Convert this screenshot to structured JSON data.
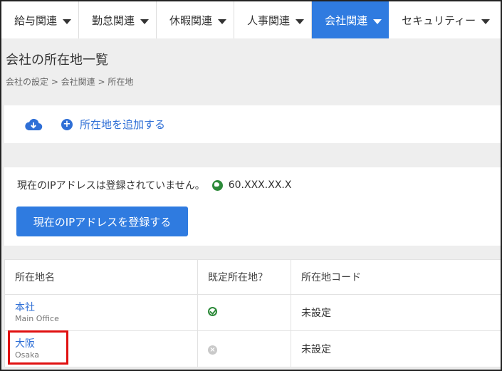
{
  "nav": {
    "items": [
      {
        "label": "給与関連",
        "active": false
      },
      {
        "label": "勤怠関連",
        "active": false
      },
      {
        "label": "休暇関連",
        "active": false
      },
      {
        "label": "人事関連",
        "active": false
      },
      {
        "label": "会社関連",
        "active": true
      },
      {
        "label": "セキュリティー",
        "active": false
      }
    ]
  },
  "page": {
    "title": "会社の所在地一覧",
    "breadcrumb": "会社の設定 > 会社関連 > 所在地"
  },
  "actions": {
    "cloud_icon": "cloud-download-icon",
    "add_label": "所在地を追加する"
  },
  "ip": {
    "message": "現在のIPアドレスは登録されていません。",
    "address": "60.XXX.XX.X",
    "register_label": "現在のIPアドレスを登録する"
  },
  "table": {
    "headers": [
      "所在地名",
      "既定所在地？",
      "所在地コード"
    ],
    "rows": [
      {
        "name": "本社",
        "sub": "Main Office",
        "default_icon": "check-circle-icon",
        "code": "未設定"
      },
      {
        "name": "大阪",
        "sub": "Osaka",
        "default_icon": "x-circle-icon",
        "code": "未設定"
      }
    ]
  },
  "colors": {
    "accent": "#2f7be0",
    "link": "#2f6fd6",
    "success": "#2d8a3a",
    "highlight": "#e01010"
  }
}
